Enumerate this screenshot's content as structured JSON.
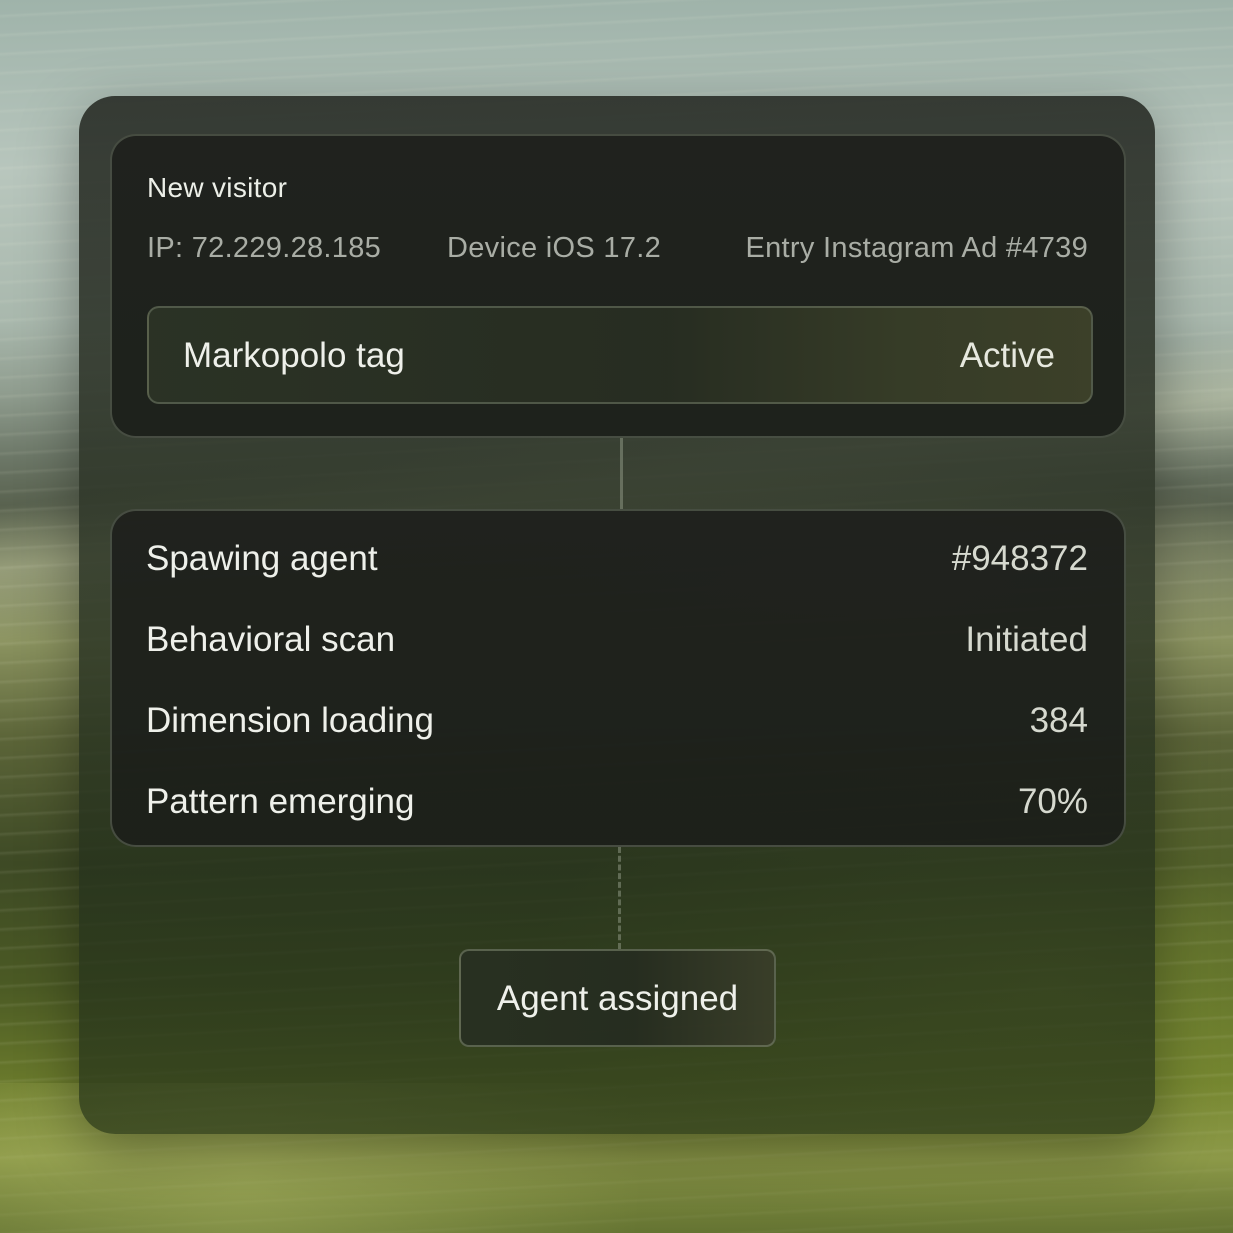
{
  "visitor": {
    "title": "New visitor",
    "ip": "IP: 72.229.28.185",
    "device": "Device iOS 17.2",
    "entry": "Entry Instagram Ad #4739"
  },
  "tag": {
    "label": "Markopolo tag",
    "status": "Active"
  },
  "pipeline": {
    "rows": [
      {
        "label": "Spawing agent",
        "value": "#948372"
      },
      {
        "label": "Behavioral scan",
        "value": "Initiated"
      },
      {
        "label": "Dimension loading",
        "value": "384"
      },
      {
        "label": "Pattern emerging",
        "value": "70%"
      }
    ]
  },
  "action": {
    "label": "Agent assigned"
  },
  "colors": {
    "panel": "#2c3226",
    "card": "#1e201c",
    "text_primary": "#eef0ea",
    "text_secondary": "#a9ada5"
  }
}
